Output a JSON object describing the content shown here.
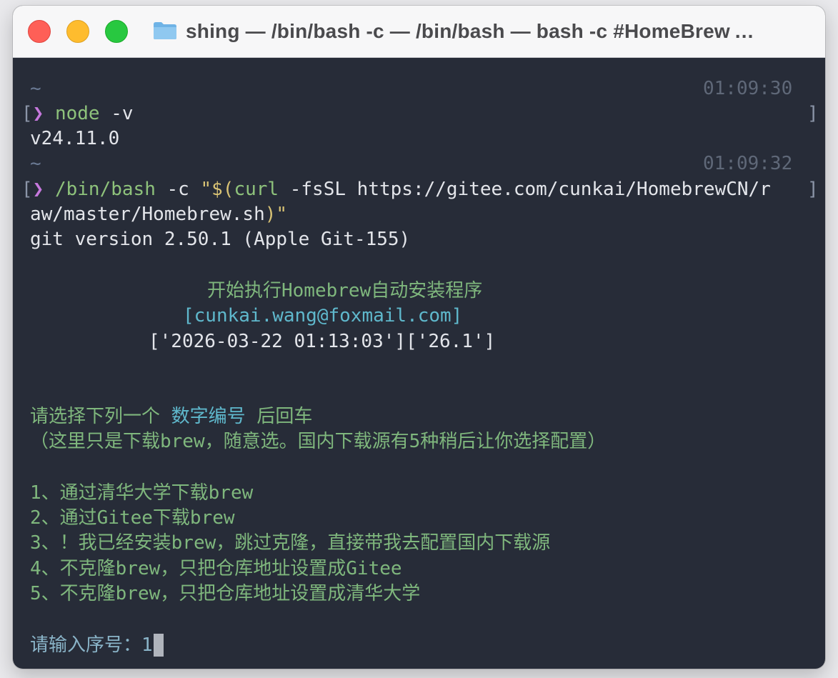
{
  "window": {
    "title": "shing — /bin/bash -c  — /bin/bash — bash -c #HomeBrew …"
  },
  "terminal": {
    "block1": {
      "tilde": "~",
      "timestamp": "01:09:30",
      "prompt_open": "[",
      "prompt_symbol": "❯",
      "command": "node",
      "args": "-v",
      "prompt_close": "]",
      "output": "v24.11.0"
    },
    "block2": {
      "tilde": "~",
      "timestamp": "01:09:32",
      "prompt_open": "[",
      "prompt_symbol": "❯",
      "command": "/bin/bash",
      "args": "-c",
      "quote_open": "\"$(",
      "sub_command": "curl",
      "sub_args": "-fsSL",
      "url_line1": "https://gitee.com/cunkai/HomebrewCN/r",
      "prompt_close": "]",
      "url_line2": "aw/master/Homebrew.sh",
      "quote_close": ")\"",
      "git_version": "git version 2.50.1 (Apple Git-155)"
    },
    "installer": {
      "heading": "开始执行Homebrew自动安装程序",
      "email": "[cunkai.wang@foxmail.com]",
      "datetime_version": "['2026-03-22 01:13:03']['26.1']",
      "choose_prefix": "请选择下列一个 ",
      "choose_highlight": "数字编号",
      "choose_suffix": " 后回车",
      "choose_note": "（这里只是下载brew，随意选。国内下载源有5种稍后让你选择配置）",
      "options": [
        "1、通过清华大学下载brew",
        "2、通过Gitee下载brew",
        "3、！我已经安装brew，跳过克隆，直接带我去配置国内下载源",
        "4、不克隆brew，只把仓库地址设置成Gitee",
        "5、不克隆brew，只把仓库地址设置成清华大学"
      ],
      "input_prompt": "请输入序号：",
      "input_value": "1"
    }
  },
  "colors": {
    "terminal_bg": "#272c38",
    "titlebar_bg": "#f7f7f8",
    "green_text": "#7fb77d",
    "cyan_text": "#5fb8cc",
    "prompt_symbol": "#c678dd"
  }
}
